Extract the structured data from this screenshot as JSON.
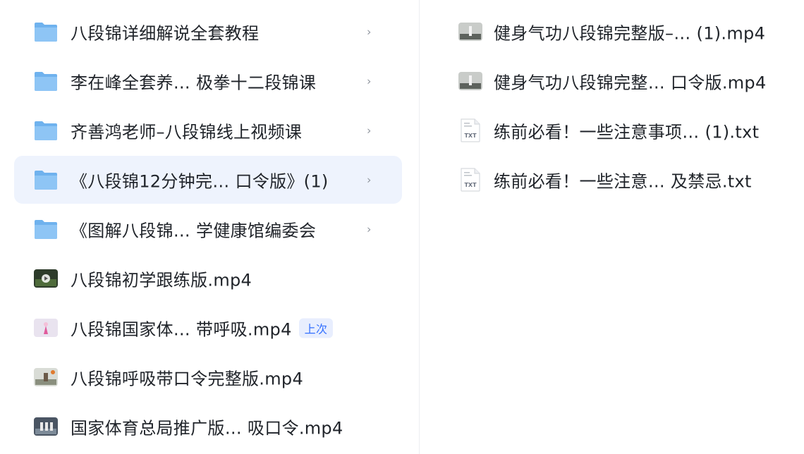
{
  "left_list": {
    "items": [
      {
        "type": "folder",
        "label": "八段锦详细解说全套教程"
      },
      {
        "type": "folder",
        "label": "李在峰全套养… 极拳十二段锦课"
      },
      {
        "type": "folder",
        "label": "齐善鸿老师–八段锦线上视频课"
      },
      {
        "type": "folder",
        "label": "《八段锦12分钟完… 口令版》(1)",
        "selected": true
      },
      {
        "type": "folder",
        "label": "《图解八段锦… 学健康馆编委会"
      },
      {
        "type": "video",
        "label": "八段锦初学跟练版.mp4"
      },
      {
        "type": "video",
        "label": "八段锦国家体…   带呼吸.mp4",
        "badge": "上次"
      },
      {
        "type": "video",
        "label": "八段锦呼吸带口令完整版.mp4"
      },
      {
        "type": "video",
        "label": "国家体育总局推广版… 吸口令.mp4"
      }
    ],
    "chevron": "›"
  },
  "right_list": {
    "items": [
      {
        "type": "video",
        "label": "健身气功八段锦完整版–… (1).mp4"
      },
      {
        "type": "video",
        "label": "健身气功八段锦完整… 口令版.mp4"
      },
      {
        "type": "txt",
        "label": "练前必看！一些注意事项…  (1).txt",
        "icon_text": "TXT"
      },
      {
        "type": "txt",
        "label": "练前必看！一些注意…   及禁忌.txt",
        "icon_text": "TXT"
      }
    ]
  },
  "colors": {
    "folder": "#8ec5f5",
    "folder_dark": "#6fb2ee",
    "selected_bg": "#eef3fd",
    "badge_text": "#3370ff",
    "badge_bg": "#e8eefe"
  }
}
